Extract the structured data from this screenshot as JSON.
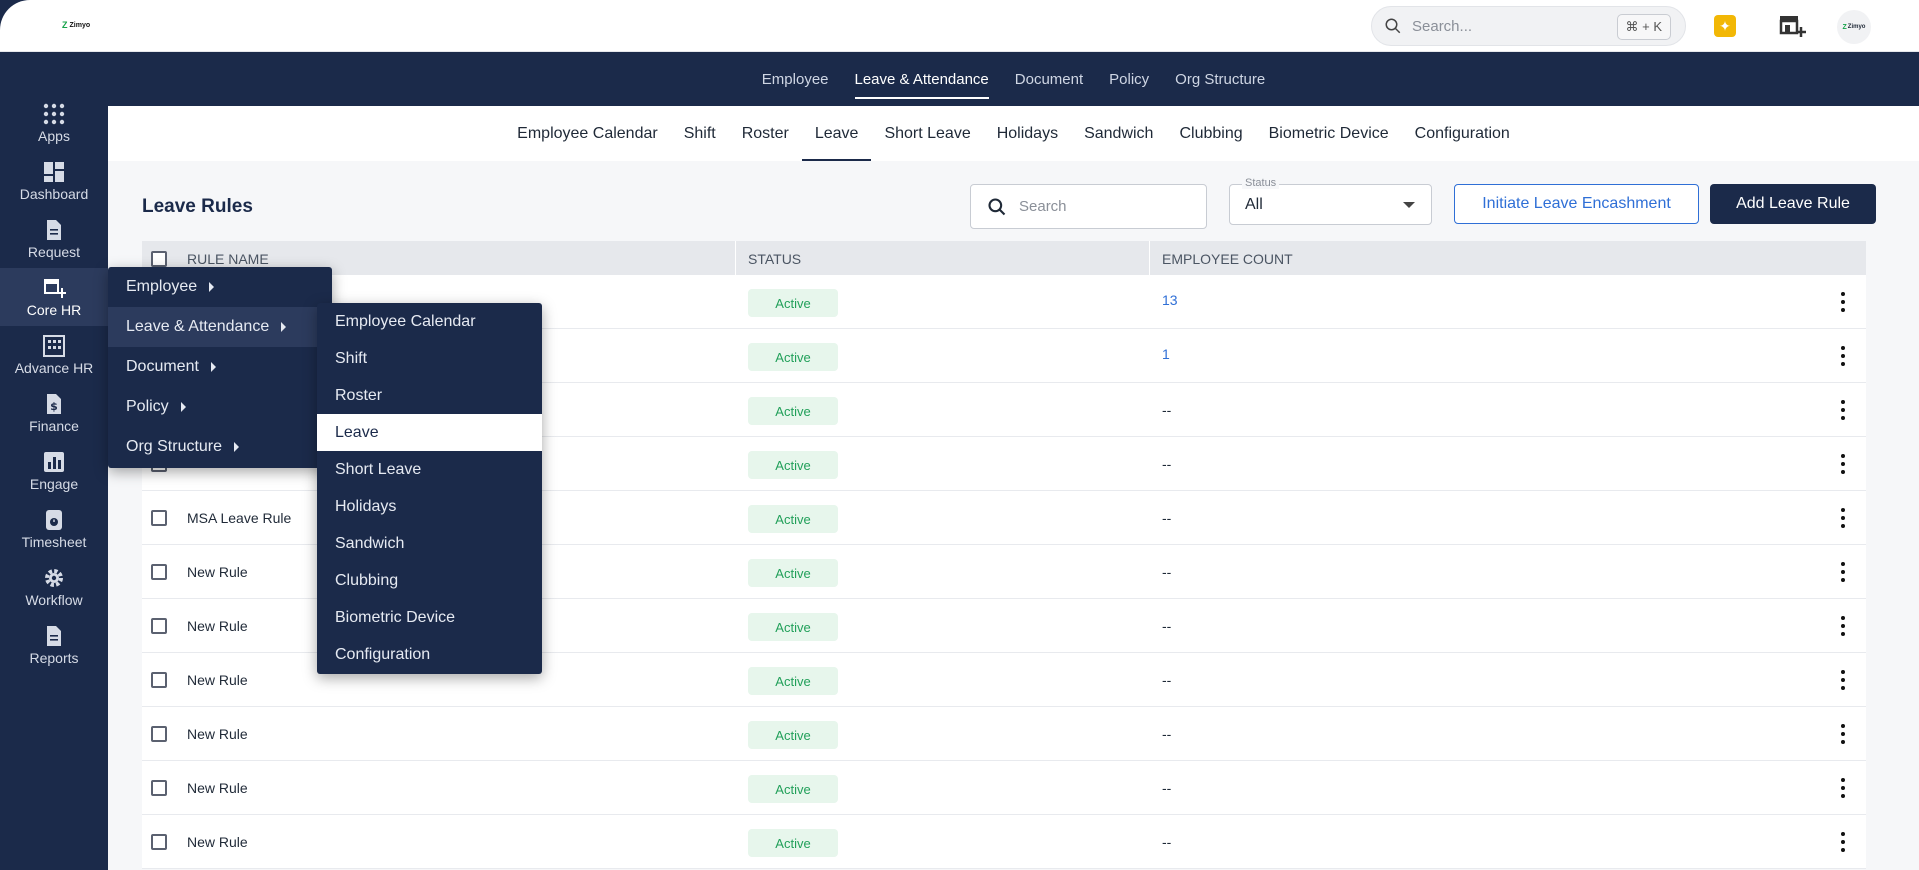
{
  "brand": {
    "logo_text": "Zimyo",
    "avatar_text": "Zimyo",
    "accent": "#1b2a4a",
    "link": "#2f6fd6",
    "active_green": "#22a05a"
  },
  "topbar": {
    "search_placeholder": "Search...",
    "shortcut": "⌘ + K"
  },
  "sidebar": {
    "items": [
      {
        "label": "Apps",
        "icon": "apps-grid-icon"
      },
      {
        "label": "Dashboard",
        "icon": "dashboard-icon"
      },
      {
        "label": "Request",
        "icon": "document-icon"
      },
      {
        "label": "Core HR",
        "icon": "store-add-icon"
      },
      {
        "label": "Advance HR",
        "icon": "building-icon"
      },
      {
        "label": "Finance",
        "icon": "finance-icon"
      },
      {
        "label": "Engage",
        "icon": "chart-icon"
      },
      {
        "label": "Timesheet",
        "icon": "timer-icon"
      },
      {
        "label": "Workflow",
        "icon": "gear-icon"
      },
      {
        "label": "Reports",
        "icon": "report-icon"
      }
    ]
  },
  "main_nav": {
    "tabs": [
      "Employee",
      "Leave & Attendance",
      "Document",
      "Policy",
      "Org Structure"
    ],
    "active": "Leave & Attendance"
  },
  "sub_nav": {
    "tabs": [
      "Employee Calendar",
      "Shift",
      "Roster",
      "Leave",
      "Short Leave",
      "Holidays",
      "Sandwich",
      "Clubbing",
      "Biometric Device",
      "Configuration"
    ],
    "active": "Leave"
  },
  "page": {
    "title": "Leave Rules",
    "search_placeholder": "Search",
    "status_label": "Status",
    "status_value": "All",
    "initiate_button": "Initiate Leave Encashment",
    "add_button": "Add Leave Rule"
  },
  "table": {
    "headers": {
      "name": "RULE NAME",
      "status": "STATUS",
      "count": "EMPLOYEE COUNT"
    },
    "rows": [
      {
        "name": "",
        "status": "Active",
        "count": "13"
      },
      {
        "name": "",
        "status": "Active",
        "count": "1"
      },
      {
        "name": "",
        "status": "Active",
        "count": "--"
      },
      {
        "name": "",
        "status": "Active",
        "count": "--"
      },
      {
        "name": "MSA Leave Rule",
        "status": "Active",
        "count": "--"
      },
      {
        "name": "New Rule",
        "status": "Active",
        "count": "--"
      },
      {
        "name": "New Rule",
        "status": "Active",
        "count": "--"
      },
      {
        "name": "New Rule",
        "status": "Active",
        "count": "--"
      },
      {
        "name": "New Rule",
        "status": "Active",
        "count": "--"
      },
      {
        "name": "New Rule",
        "status": "Active",
        "count": "--"
      },
      {
        "name": "New Rule",
        "status": "Active",
        "count": "--"
      }
    ]
  },
  "flyout": {
    "level1": [
      "Employee",
      "Leave & Attendance",
      "Document",
      "Policy",
      "Org Structure"
    ],
    "level1_highlighted": "Leave & Attendance",
    "level2": [
      "Employee Calendar",
      "Shift",
      "Roster",
      "Leave",
      "Short Leave",
      "Holidays",
      "Sandwich",
      "Clubbing",
      "Biometric Device",
      "Configuration"
    ],
    "level2_selected": "Leave"
  }
}
